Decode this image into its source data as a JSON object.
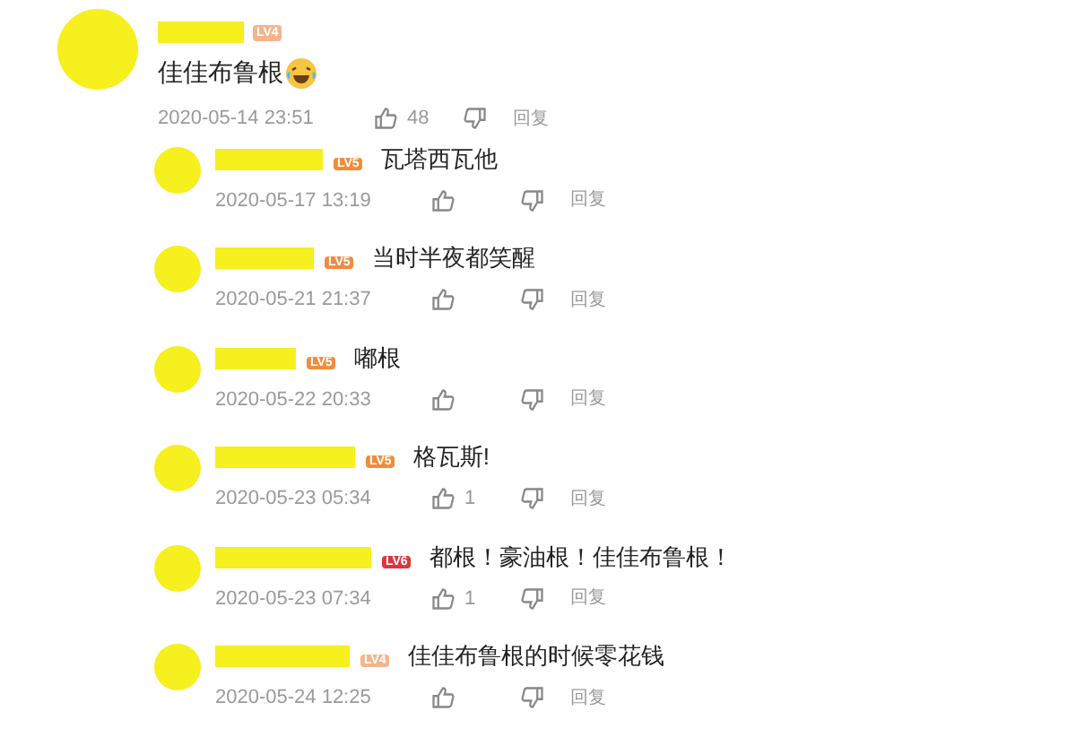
{
  "comments": [
    {
      "badge": "LV4",
      "color": "#f5b48c",
      "text": "佳佳布鲁根",
      "emoji": true,
      "time": "2020-05-14 23:51",
      "likes": "48",
      "reply_label": "回复",
      "replies": [
        {
          "badge": "LV5",
          "color": "#f08c3c",
          "text": "瓦塔西瓦他",
          "time": "2020-05-17 13:19",
          "reply_label": "回复"
        },
        {
          "badge": "LV5",
          "color": "#f08c3c",
          "text": "当时半夜都笑醒",
          "time": "2020-05-21 21:37",
          "reply_label": "回复"
        },
        {
          "badge": "LV5",
          "color": "#f08c3c",
          "text": "嘟根",
          "time": "2020-05-22 20:33",
          "reply_label": "回复"
        },
        {
          "badge": "LV5",
          "color": "#f08c3c",
          "text": "格瓦斯!",
          "time": "2020-05-23 05:34",
          "likes": "1",
          "reply_label": "回复"
        },
        {
          "badge": "LV6",
          "color": "#e0343c",
          "text": "都根！豪油根！佳佳布鲁根！",
          "time": "2020-05-23 07:34",
          "likes": "1",
          "reply_label": "回复"
        },
        {
          "badge": "LV4",
          "color": "#f5b48c",
          "text": "佳佳布鲁根的时候零花钱",
          "time": "2020-05-24 12:25",
          "reply_label": "回复"
        }
      ]
    }
  ]
}
